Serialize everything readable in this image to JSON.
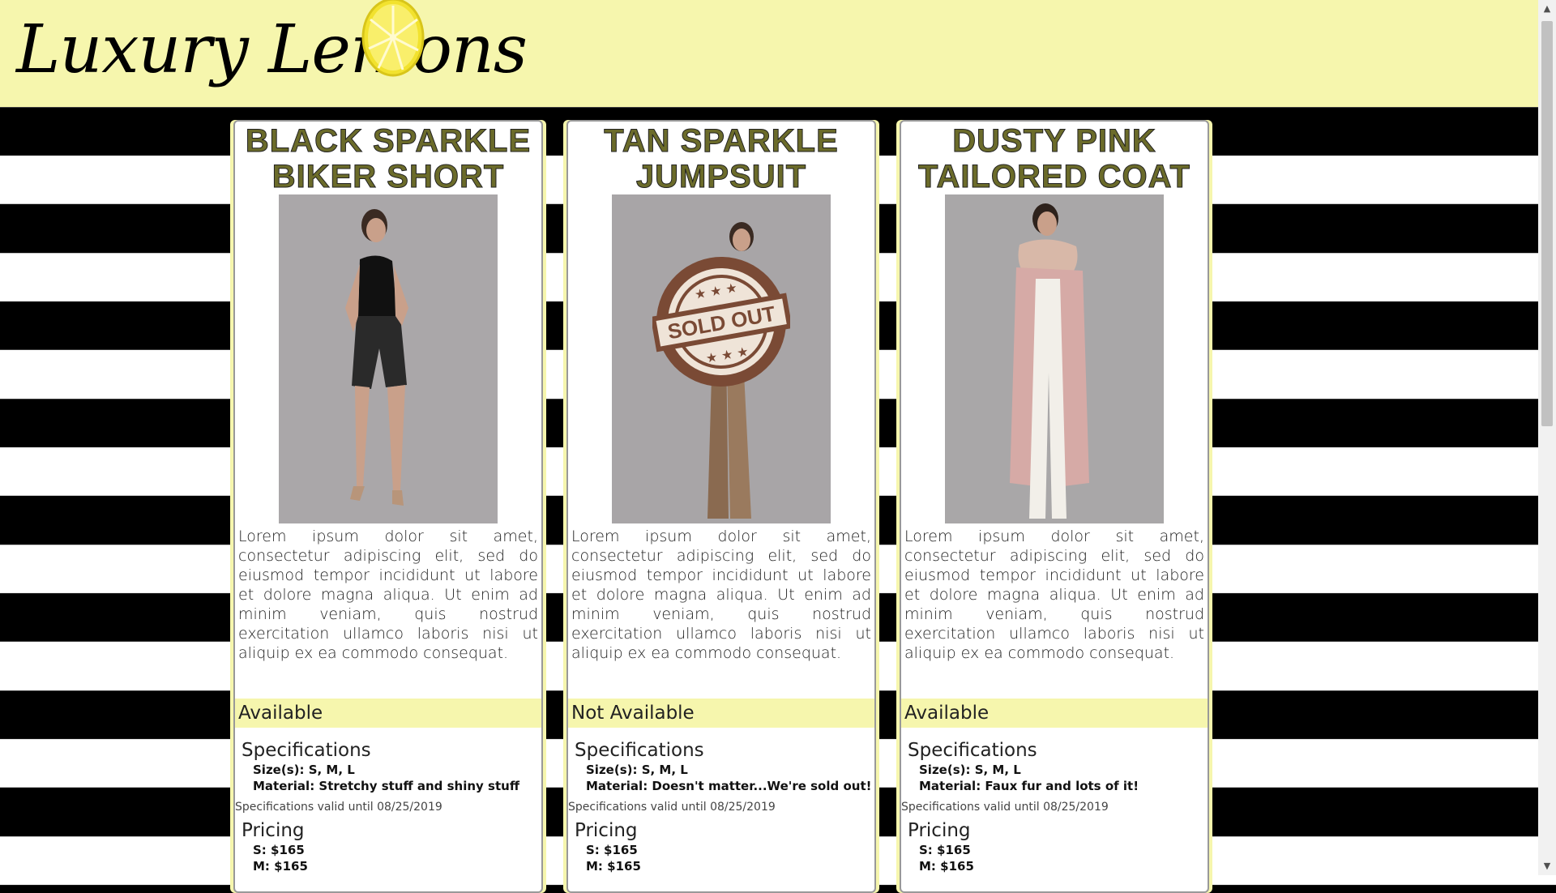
{
  "site": {
    "logo_text": "Luxury Lemons",
    "colors": {
      "header_bg": "#f6f6ad",
      "title_fill": "#6b6b2a",
      "stripe": "#000000"
    }
  },
  "products": [
    {
      "title_line1": "BLACK SPARKLE",
      "title_line2": "BIKER SHORT",
      "description": "Lorem ipsum dolor sit amet, consectetur adipiscing elit, sed do eiusmod tempor incididunt ut labore et dolore magna aliqua. Ut enim ad minim veniam, quis nostrud exercitation ullamco laboris nisi ut aliquip ex ea commodo consequat.",
      "availability": "Available",
      "specs_heading": "Specifications",
      "sizes": "Size(s): S, M, L",
      "material": "Material: Stretchy stuff and shiny stuff",
      "valid_until": "Specifications valid until 08/25/2019",
      "pricing_heading": "Pricing",
      "price_s": "S: $165",
      "price_m": "M: $165"
    },
    {
      "title_line1": "TAN SPARKLE",
      "title_line2": "JUMPSUIT",
      "description": "Lorem ipsum dolor sit amet, consectetur adipiscing elit, sed do eiusmod tempor incididunt ut labore et dolore magna aliqua. Ut enim ad minim veniam, quis nostrud exercitation ullamco laboris nisi ut aliquip ex ea commodo consequat.",
      "availability": "Not Available",
      "stamp_text": "SOLD OUT",
      "specs_heading": "Specifications",
      "sizes": "Size(s): S, M, L",
      "material": "Material: Doesn't matter...We're sold out!",
      "valid_until": "Specifications valid until 08/25/2019",
      "pricing_heading": "Pricing",
      "price_s": "S: $165",
      "price_m": "M: $165"
    },
    {
      "title_line1": "DUSTY PINK",
      "title_line2": "TAILORED COAT",
      "description": "Lorem ipsum dolor sit amet, consectetur adipiscing elit, sed do eiusmod tempor incididunt ut labore et dolore magna aliqua. Ut enim ad minim veniam, quis nostrud exercitation ullamco laboris nisi ut aliquip ex ea commodo consequat.",
      "availability": "Available",
      "specs_heading": "Specifications",
      "sizes": "Size(s): S, M, L",
      "material": "Material: Faux fur and lots of it!",
      "valid_until": "Specifications valid until 08/25/2019",
      "pricing_heading": "Pricing",
      "price_s": "S: $165",
      "price_m": "M: $165"
    }
  ]
}
